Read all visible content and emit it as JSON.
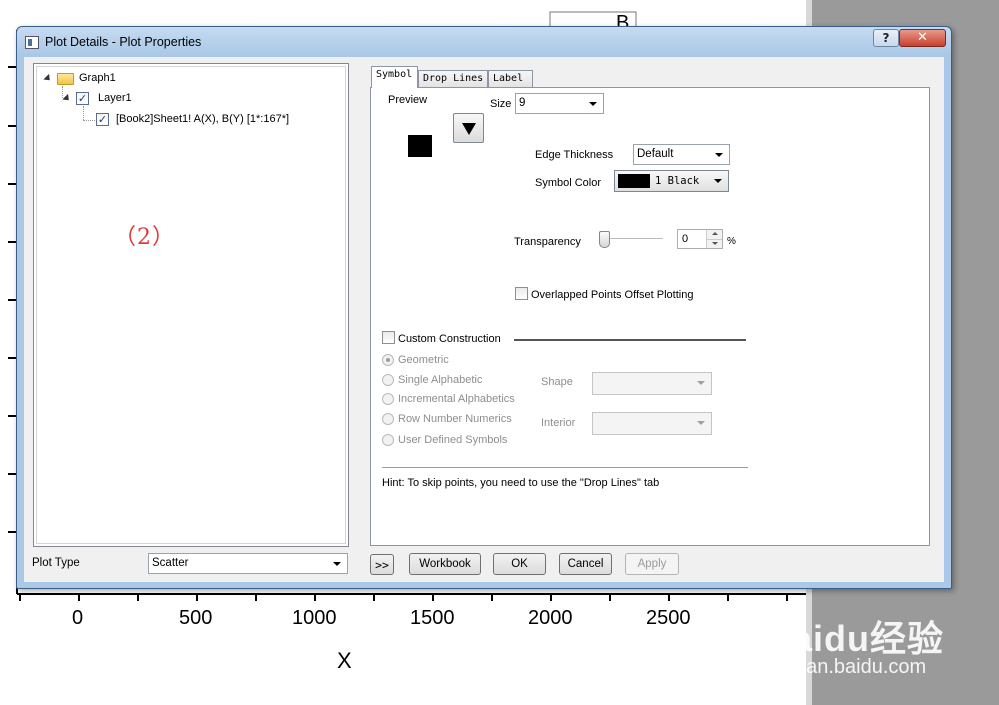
{
  "background": {
    "x_ticks": [
      "0",
      "500",
      "1000",
      "1500",
      "2000",
      "2500"
    ],
    "x_axis_title": "X",
    "watermark_brand": "Baidu经验",
    "watermark_url": "jingyan.baidu.com",
    "legend_fragment": "B"
  },
  "dialog": {
    "title": "Plot Details - Plot Properties",
    "help_label": "?",
    "close_label": "✕"
  },
  "tree": {
    "graph": "Graph1",
    "layer": "Layer1",
    "dataset": "[Book2]Sheet1! A(X), B(Y) [1*:167*]",
    "check_mark": "✓",
    "annotation": "（2）"
  },
  "plot_type": {
    "label": "Plot Type",
    "value": "Scatter"
  },
  "tabs": [
    {
      "label": "Symbol"
    },
    {
      "label": "Drop Lines"
    },
    {
      "label": "Label"
    }
  ],
  "symbol": {
    "preview_label": "Preview",
    "size_label": "Size",
    "size_value": "9",
    "edge_thickness_label": "Edge Thickness",
    "edge_thickness_value": "Default",
    "symbol_color_label": "Symbol Color",
    "symbol_color_value": "1 Black",
    "symbol_color_hex": "#000000",
    "transparency_label": "Transparency",
    "transparency_value": "0",
    "transparency_unit": "%",
    "overlapped_label": "Overlapped Points Offset Plotting",
    "custom_construction_label": "Custom Construction",
    "radio_options": [
      "Geometric",
      "Single Alphabetic",
      "Incremental Alphabetics",
      "Row Number Numerics",
      "User Defined Symbols"
    ],
    "shape_label": "Shape",
    "interior_label": "Interior",
    "hint": "Hint: To skip points, you need to use the \"Drop Lines\" tab"
  },
  "buttons": {
    "expand": ">>",
    "workbook": "Workbook",
    "ok": "OK",
    "cancel": "Cancel",
    "apply": "Apply"
  }
}
